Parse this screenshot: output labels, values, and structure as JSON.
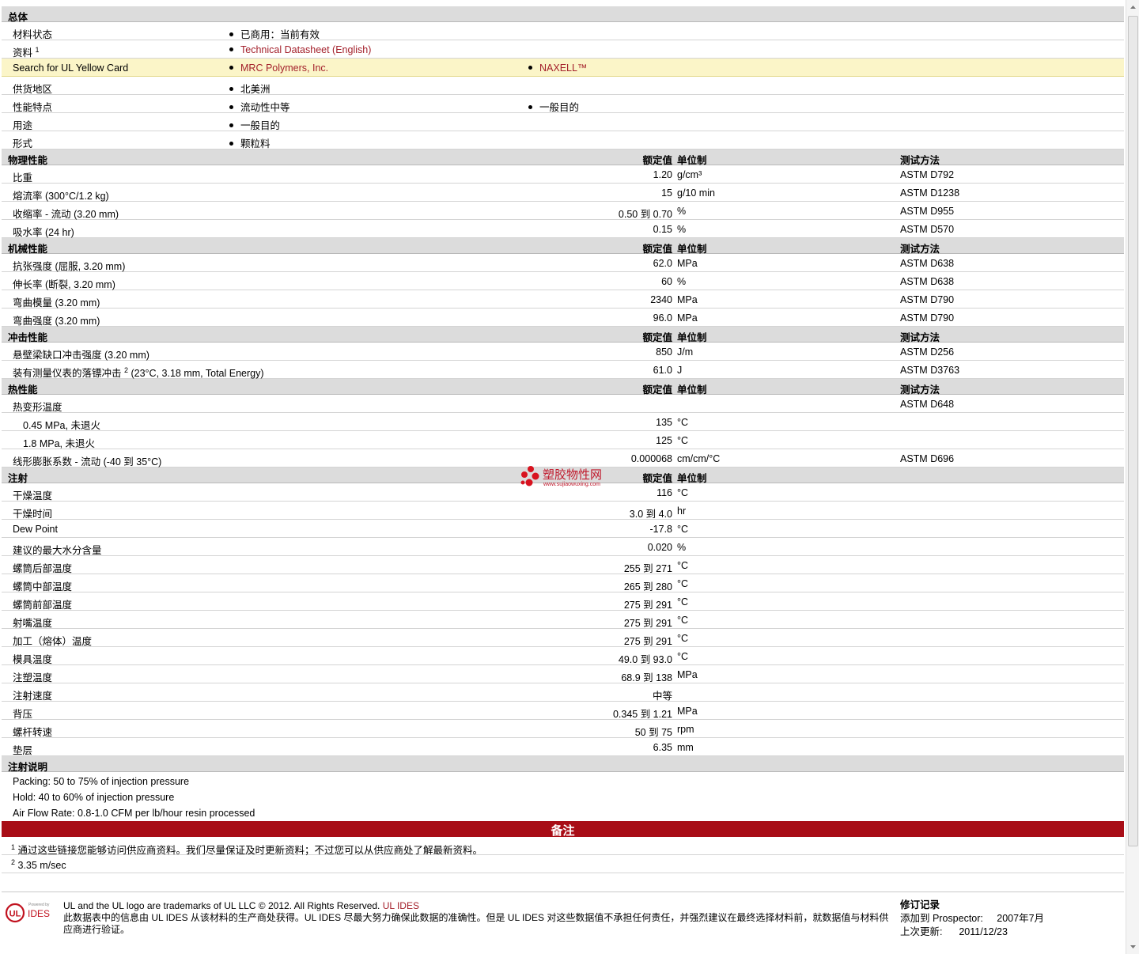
{
  "general": {
    "title": "总体",
    "material_status": {
      "label": "材料状态",
      "value": "已商用：当前有效"
    },
    "documents": {
      "label": "资料",
      "sup": "1",
      "value": "Technical Datasheet (English)"
    },
    "yellow_card": {
      "label": "Search for UL Yellow Card",
      "value1": "MRC Polymers, Inc.",
      "value2": "NAXELL™"
    },
    "supply_region": {
      "label": "供货地区",
      "value": "北美洲"
    },
    "features": {
      "label": "性能特点",
      "value1": "流动性中等",
      "value2": "一般目的"
    },
    "uses": {
      "label": "用途",
      "value": "一般目的"
    },
    "form": {
      "label": "形式",
      "value": "颗粒料"
    }
  },
  "headers": {
    "rated": "额定值",
    "unit": "单位制",
    "test": "测试方法"
  },
  "physical": {
    "title": "物理性能",
    "rows": [
      {
        "label": "比重",
        "value": "1.20",
        "unit": "g/cm³",
        "test": "ASTM D792"
      },
      {
        "label": "熔流率  (300°C/1.2 kg)",
        "value": "15",
        "unit": "g/10 min",
        "test": "ASTM D1238"
      },
      {
        "label": "收缩率  - 流动  (3.20 mm)",
        "value": "0.50 到  0.70",
        "unit": "%",
        "test": "ASTM D955"
      },
      {
        "label": "吸水率  (24 hr)",
        "value": "0.15",
        "unit": "%",
        "test": "ASTM D570"
      }
    ]
  },
  "mechanical": {
    "title": "机械性能",
    "rows": [
      {
        "label": "抗张强度  (屈服, 3.20 mm)",
        "value": "62.0",
        "unit": "MPa",
        "test": "ASTM D638"
      },
      {
        "label": "伸长率  (断裂, 3.20 mm)",
        "value": "60",
        "unit": "%",
        "test": "ASTM D638"
      },
      {
        "label": "弯曲模量  (3.20 mm)",
        "value": "2340",
        "unit": "MPa",
        "test": "ASTM D790"
      },
      {
        "label": "弯曲强度  (3.20 mm)",
        "value": "96.0",
        "unit": "MPa",
        "test": "ASTM D790"
      }
    ]
  },
  "impact": {
    "title": "冲击性能",
    "rows": [
      {
        "label": "悬壁梁缺口冲击强度  (3.20 mm)",
        "value": "850",
        "unit": "J/m",
        "test": "ASTM D256"
      },
      {
        "label": "装有测量仪表的落镖冲击",
        "sup": "2",
        "label_tail": " (23°C, 3.18 mm, Total Energy)",
        "value": "61.0",
        "unit": "J",
        "test": "ASTM D3763"
      }
    ]
  },
  "thermal": {
    "title": "热性能",
    "hdt": {
      "label": "热变形温度",
      "test": "ASTM D648"
    },
    "rows": [
      {
        "label": "0.45 MPa, 未退火",
        "value": "135",
        "unit": "°C"
      },
      {
        "label": "1.8 MPa, 未退火",
        "value": "125",
        "unit": "°C"
      }
    ],
    "clte": {
      "label": "线形膨胀系数  - 流动  (-40 到  35°C)",
      "value": "0.000068",
      "unit": "cm/cm/°C",
      "test": "ASTM D696"
    }
  },
  "injection": {
    "title": "注射",
    "rows": [
      {
        "label": "干燥温度",
        "value": "116",
        "unit": "°C"
      },
      {
        "label": "干燥时间",
        "value": "3.0 到  4.0",
        "unit": "hr"
      },
      {
        "label": "Dew Point",
        "value": "-17.8",
        "unit": "°C"
      },
      {
        "label": "建议的最大水分含量",
        "value": "0.020",
        "unit": "%"
      },
      {
        "label": "螺筒后部温度",
        "value": "255 到  271",
        "unit": "°C"
      },
      {
        "label": "螺筒中部温度",
        "value": "265 到  280",
        "unit": "°C"
      },
      {
        "label": "螺筒前部温度",
        "value": "275 到  291",
        "unit": "°C"
      },
      {
        "label": "射嘴温度",
        "value": "275 到  291",
        "unit": "°C"
      },
      {
        "label": "加工（熔体）温度",
        "value": "275 到  291",
        "unit": "°C"
      },
      {
        "label": "模具温度",
        "value": "49.0 到  93.0",
        "unit": "°C"
      },
      {
        "label": "注塑温度",
        "value": "68.9 到  138",
        "unit": "MPa"
      },
      {
        "label": "注射速度",
        "value": "中等",
        "unit": ""
      },
      {
        "label": "背压",
        "value": "0.345 到  1.21",
        "unit": "MPa"
      },
      {
        "label": "螺杆转速",
        "value": "50 到  75",
        "unit": "rpm"
      },
      {
        "label": "垫层",
        "value": "6.35",
        "unit": "mm"
      }
    ]
  },
  "injection_notes": {
    "title": "注射说明",
    "lines": [
      "Packing: 50 to 75% of injection pressure",
      "Hold: 40 to 60% of injection pressure",
      "Air Flow Rate: 0.8-1.0 CFM per lb/hour resin processed"
    ]
  },
  "remarks": {
    "title": "备注",
    "notes": [
      {
        "sup": "1",
        "text": "通过这些链接您能够访问供应商资料。我们尽量保证及时更新资料；不过您可以从供应商处了解最新资料。"
      },
      {
        "sup": "2",
        "text": "3.35 m/sec"
      }
    ]
  },
  "footer": {
    "logo_text": "UL IDES",
    "logo_small": "Powered by",
    "trademark": "UL and the UL logo are trademarks of UL LLC © 2012. All Rights Reserved.",
    "trademark_link": "UL IDES",
    "disclaimer": "此数据表中的信息由  UL IDES 从该材料的生产商处获得。UL IDES 尽最大努力确保此数据的准确性。但是  UL IDES 对这些数据值不承担任何责任，并强烈建议在最终选择材料前，就数据值与材料供应商进行验证。",
    "revision_title": "修订记录",
    "added_label": "添加到  Prospector:",
    "added_value": "2007年7月",
    "updated_label": "上次更新:",
    "updated_value": "2011/12/23"
  },
  "watermark": {
    "text": "塑胶物性网",
    "url": "www.sujiaowuxing.com"
  },
  "colors": {
    "accent": "#a80d16",
    "link": "#a31f2a",
    "highlight": "#fbf5c8",
    "section": "#dcdcdc"
  }
}
